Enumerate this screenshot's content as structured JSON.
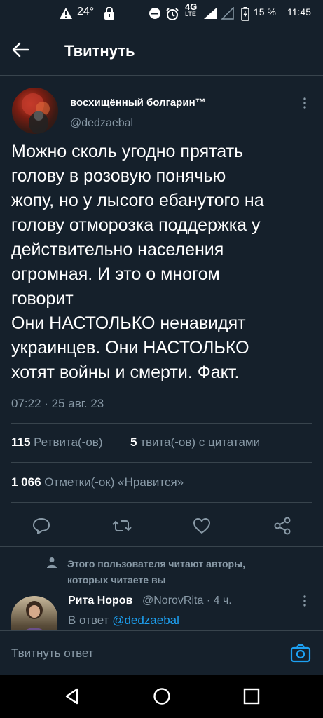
{
  "status_bar": {
    "temperature": "24°",
    "network": "4G",
    "network_sub": "LTE",
    "battery": "15 %",
    "time": "11:45"
  },
  "header": {
    "title": "Твитнуть"
  },
  "tweet": {
    "author_name": "восхищённый болгарин™",
    "author_handle": "@dedzaebal",
    "text_lines": [
      "Можно сколь угодно прятать",
      "голову в розовую понячью",
      "жопу, но у лысого ебанутого на",
      "голову отморозка поддержка у",
      "действительно населения",
      "огромная. И это о многом",
      "говорит",
      "Они НАСТОЛЬКО ненавидят",
      "украинцев. Они НАСТОЛЬКО",
      "хотят войны и смерти. Факт."
    ],
    "timestamp": "07:22 · 25 авг. 23",
    "retweets_count": "115",
    "retweets_label": "Ретвита(-ов)",
    "quotes_count": "5",
    "quotes_label": "твита(-ов) с цитатами",
    "likes_count": "1 066",
    "likes_label": "Отметки(-ок) «Нравится»"
  },
  "actions": [
    "reply-icon",
    "retweet-icon",
    "like-icon",
    "share-icon"
  ],
  "follow_note": {
    "line1": "Этого пользователя читают авторы,",
    "line2": "которых читаете вы"
  },
  "reply": {
    "author_name": "Рита Норов",
    "author_handle": "@NorovRita · 4 ч.",
    "reply_to_label": "В ответ",
    "reply_to_handle": "@dedzaebal"
  },
  "composer": {
    "placeholder": "Твитнуть ответ"
  },
  "colors": {
    "background": "#15202b",
    "secondary_text": "#8899a6",
    "accent": "#1da1f2",
    "divider": "#38444d"
  }
}
